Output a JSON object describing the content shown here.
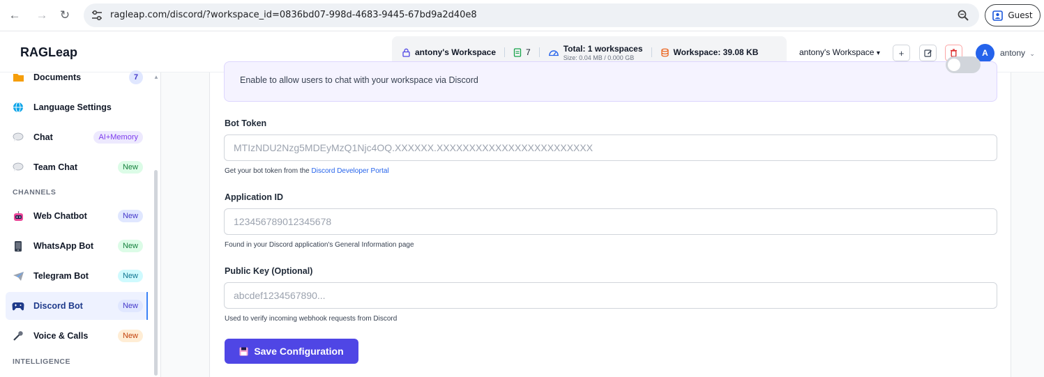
{
  "browser": {
    "url": "ragleap.com/discord/?workspace_id=0836bd07-998d-4683-9445-67bd9a2d40e8",
    "profile_label": "Guest"
  },
  "header": {
    "brand": "RAGLeap",
    "stats": {
      "workspace_name": "antony's Workspace",
      "doc_count": "7",
      "total_label": "Total: 1 workspaces",
      "size_label": "Size: 0.04 MB / 0.000 GB",
      "workspace_size": "Workspace: 39.08 KB"
    },
    "workspace_select": "antony's Workspace",
    "user_initial": "A",
    "user_name": "antony"
  },
  "sidebar": {
    "items": [
      {
        "label": "Documents",
        "badge": "7"
      },
      {
        "label": "Language Settings"
      },
      {
        "label": "Chat",
        "badge": "AI+Memory"
      },
      {
        "label": "Team Chat",
        "badge": "New"
      }
    ],
    "section_channels": "CHANNELS",
    "channels": [
      {
        "label": "Web Chatbot",
        "badge": "New"
      },
      {
        "label": "WhatsApp Bot",
        "badge": "New"
      },
      {
        "label": "Telegram Bot",
        "badge": "New"
      },
      {
        "label": "Discord Bot",
        "badge": "New"
      },
      {
        "label": "Voice & Calls",
        "badge": "New"
      }
    ],
    "section_intelligence": "INTELLIGENCE"
  },
  "main": {
    "enable_desc": "Enable to allow users to chat with your workspace via Discord",
    "bot_token": {
      "label": "Bot Token",
      "placeholder": "MTIzNDU2Nzg5MDEyMzQ1Njc4OQ.XXXXXX.XXXXXXXXXXXXXXXXXXXXXXXX",
      "help_prefix": "Get your bot token from the ",
      "help_link": "Discord Developer Portal"
    },
    "app_id": {
      "label": "Application ID",
      "placeholder": "123456789012345678",
      "help": "Found in your Discord application's General Information page"
    },
    "public_key": {
      "label": "Public Key (Optional)",
      "placeholder": "abcdef1234567890...",
      "help": "Used to verify incoming webhook requests from Discord"
    },
    "save_label": "Save Configuration"
  }
}
